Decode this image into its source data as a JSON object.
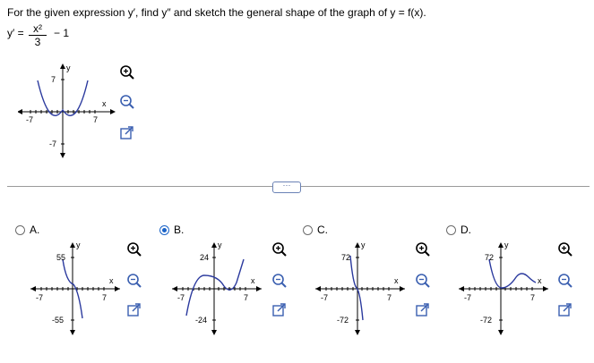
{
  "question": "For the given expression y′, find y″ and sketch the general shape of the graph of y = f(x).",
  "expression": {
    "lhs": "y′ =",
    "numerator": "x²",
    "denominator": "3",
    "rest": "− 1"
  },
  "main_graph": {
    "y_label": "y",
    "x_label": "x",
    "y_top": "7",
    "y_bottom": "-7",
    "x_left": "-7",
    "x_right": "7"
  },
  "more_label": "···",
  "options": [
    {
      "letter": "A.",
      "selected": false,
      "y_top": "55",
      "y_bottom": "-55",
      "x_left": "-7",
      "x_right": "7",
      "y_label": "y",
      "x_label": "x"
    },
    {
      "letter": "B.",
      "selected": true,
      "y_top": "24",
      "y_bottom": "-24",
      "x_left": "-7",
      "x_right": "7",
      "y_label": "y",
      "x_label": "x"
    },
    {
      "letter": "C.",
      "selected": false,
      "y_top": "72",
      "y_bottom": "-72",
      "x_left": "-7",
      "x_right": "7",
      "y_label": "y",
      "x_label": "x"
    },
    {
      "letter": "D.",
      "selected": false,
      "y_top": "72",
      "y_bottom": "-72",
      "x_left": "-7",
      "x_right": "7",
      "y_label": "y",
      "x_label": "x"
    }
  ],
  "icons": {
    "zoom_in": "zoom-in-icon",
    "zoom_out": "zoom-out-icon",
    "popout": "popout-icon"
  },
  "colors": {
    "curve": "#2b3a9e",
    "accent": "#1a63c7"
  }
}
